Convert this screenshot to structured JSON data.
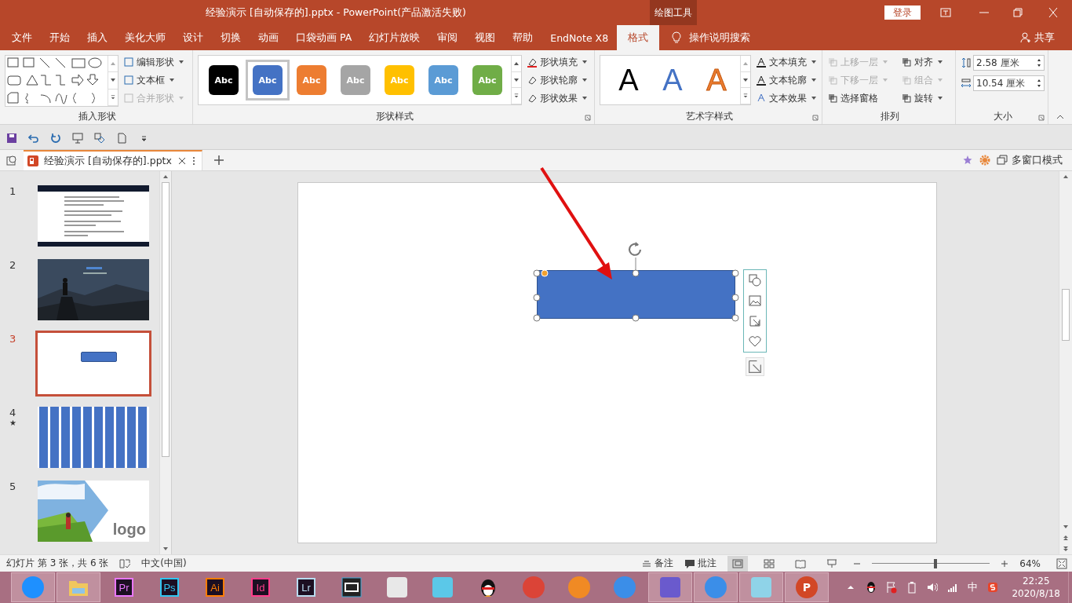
{
  "title_bar": {
    "title": "经验演示 [自动保存的].pptx  -  PowerPoint(产品激活失败)",
    "context_label": "绘图工具",
    "login": "登录"
  },
  "tabs": [
    {
      "label": "文件",
      "selected": false
    },
    {
      "label": "开始",
      "selected": false
    },
    {
      "label": "插入",
      "selected": false
    },
    {
      "label": "美化大师",
      "selected": false
    },
    {
      "label": "设计",
      "selected": false
    },
    {
      "label": "切换",
      "selected": false
    },
    {
      "label": "动画",
      "selected": false
    },
    {
      "label": "口袋动画 PA",
      "selected": false
    },
    {
      "label": "幻灯片放映",
      "selected": false
    },
    {
      "label": "审阅",
      "selected": false
    },
    {
      "label": "视图",
      "selected": false
    },
    {
      "label": "帮助",
      "selected": false
    },
    {
      "label": "EndNote X8",
      "selected": false
    },
    {
      "label": "格式",
      "selected": true
    }
  ],
  "tell_me": "操作说明搜索",
  "share": "共享",
  "ribbon": {
    "insert_shapes": {
      "label": "插入形状",
      "commands": [
        {
          "label": "编辑形状",
          "disabled": false
        },
        {
          "label": "文本框",
          "disabled": false
        },
        {
          "label": "合并形状",
          "disabled": true
        }
      ]
    },
    "shape_styles": {
      "label": "形状样式",
      "styles": [
        {
          "label": "Abc",
          "color": "#000000",
          "selected": false
        },
        {
          "label": "Abc",
          "color": "#4472c4",
          "selected": true
        },
        {
          "label": "Abc",
          "color": "#ed7d31",
          "selected": false
        },
        {
          "label": "Abc",
          "color": "#a5a5a5",
          "selected": false
        },
        {
          "label": "Abc",
          "color": "#ffc000",
          "selected": false
        },
        {
          "label": "Abc",
          "color": "#5b9bd5",
          "selected": false
        },
        {
          "label": "Abc",
          "color": "#70ad47",
          "selected": false
        }
      ],
      "commands": [
        {
          "label": "形状填充",
          "disabled": false
        },
        {
          "label": "形状轮廓",
          "disabled": false
        },
        {
          "label": "形状效果",
          "disabled": false
        }
      ]
    },
    "wordart": {
      "label": "艺术字样式",
      "samples": [
        {
          "label": "A",
          "kind": "fill",
          "color": "#000000"
        },
        {
          "label": "A",
          "kind": "fill",
          "color": "#4472c4"
        },
        {
          "label": "A",
          "kind": "outline",
          "color": "#ed7d31"
        }
      ],
      "commands": [
        {
          "label": "文本填充",
          "disabled": false
        },
        {
          "label": "文本轮廓",
          "disabled": false
        },
        {
          "label": "文本效果",
          "disabled": false
        }
      ]
    },
    "arrange": {
      "label": "排列",
      "commands": [
        {
          "label": "上移一层",
          "disabled": true
        },
        {
          "label": "对齐",
          "disabled": false
        },
        {
          "label": "下移一层",
          "disabled": true
        },
        {
          "label": "组合",
          "disabled": true
        },
        {
          "label": "选择窗格",
          "disabled": false
        },
        {
          "label": "旋转",
          "disabled": false
        }
      ]
    },
    "size": {
      "label": "大小",
      "height": "2.58 厘米",
      "width": "10.54 厘米"
    }
  },
  "doc_tab": {
    "label": "经验演示  [自动保存的].pptx",
    "multi_window": "多窗口模式"
  },
  "slides": [
    {
      "number": "1",
      "kind": "text",
      "selected": false
    },
    {
      "number": "2",
      "selected": false
    },
    {
      "number": "3",
      "kind": "shape",
      "selected": true
    },
    {
      "number": "4",
      "kind": "bars",
      "mark": "★",
      "selected": false
    },
    {
      "number": "5",
      "kind": "logo",
      "logo": "logo",
      "selected": false
    }
  ],
  "status_bar": {
    "slide_info": "幻灯片 第 3 张，共 6 张",
    "language": "中文(中国)",
    "notes": "备注",
    "comments": "批注",
    "zoom": {
      "level": 0.54,
      "reading": "64%"
    }
  },
  "taskbar": {
    "apps": [
      {
        "kind": "round",
        "color": "#1e90ff",
        "selected": true
      },
      {
        "kind": "folder",
        "color": "#f0c75e",
        "selected": true
      },
      {
        "kind": "badge",
        "label": "Pr",
        "color": "#ea77ff",
        "selected": false
      },
      {
        "kind": "badge",
        "label": "Ps",
        "color": "#31c5f0",
        "selected": false
      },
      {
        "kind": "badge",
        "label": "Ai",
        "color": "#ff7c00",
        "selected": false
      },
      {
        "kind": "badge",
        "label": "Id",
        "color": "#ff3d8b",
        "selected": false
      },
      {
        "kind": "badge",
        "label": "Lr",
        "color": "#b8dcf0",
        "selected": false
      },
      {
        "kind": "film",
        "color": "#222222",
        "selected": false
      },
      {
        "kind": "square",
        "color": "#e8e8e8",
        "selected": false
      },
      {
        "kind": "square",
        "color": "#5bc8e8",
        "selected": false
      },
      {
        "kind": "penguin",
        "color": "#111111",
        "selected": false
      },
      {
        "kind": "round",
        "color": "#db4437",
        "selected": false
      },
      {
        "kind": "round",
        "color": "#f08a24",
        "selected": false
      },
      {
        "kind": "round",
        "color": "#3b8ee8",
        "selected": false
      },
      {
        "kind": "square",
        "color": "#6a5acd",
        "selected": true
      },
      {
        "kind": "round",
        "color": "#3b8ee8",
        "selected": true
      },
      {
        "kind": "square",
        "color": "#8fd3e8",
        "selected": true
      },
      {
        "kind": "round",
        "label": "P",
        "color": "#d24726",
        "selected": true
      }
    ],
    "tray": {
      "ime": "中",
      "time": "22:25",
      "date": "2020/8/18"
    }
  }
}
